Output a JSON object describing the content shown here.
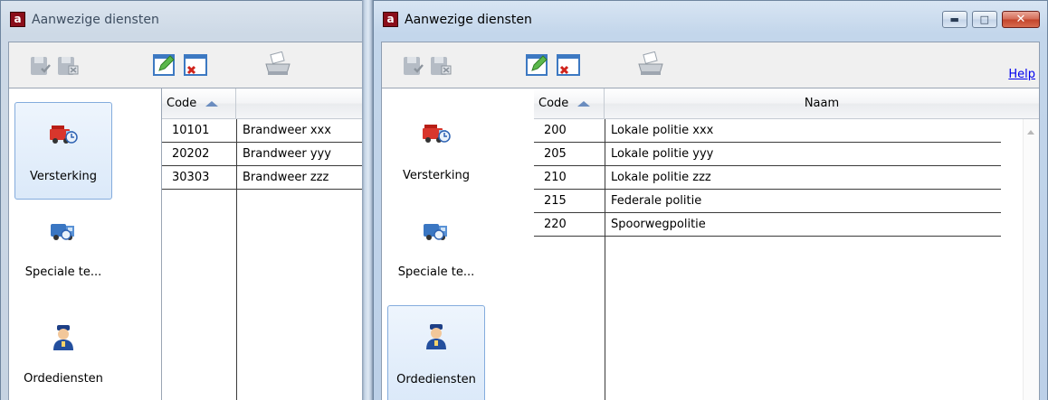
{
  "left_window": {
    "title": "Aanwezige diensten",
    "app_icon_letter": "a",
    "sidebar": [
      {
        "label": "Versterking",
        "icon": "fire-truck-icon",
        "selected": true
      },
      {
        "label": "Speciale te...",
        "icon": "special-truck-icon",
        "selected": false
      },
      {
        "label": "Ordediensten",
        "icon": "police-officer-icon",
        "selected": false
      }
    ],
    "columns": {
      "code": "Code",
      "name": ""
    },
    "rows": [
      {
        "code": "10101",
        "name": "Brandweer xxx"
      },
      {
        "code": "20202",
        "name": "Brandweer yyy"
      },
      {
        "code": "30303",
        "name": "Brandweer zzz"
      }
    ]
  },
  "right_window": {
    "title": "Aanwezige diensten",
    "app_icon_letter": "a",
    "controls": {
      "minimize": "▬",
      "maximize": "□",
      "close": "✕"
    },
    "help_label": "Help",
    "sidebar": [
      {
        "label": "Versterking",
        "icon": "fire-truck-icon",
        "selected": false
      },
      {
        "label": "Speciale te...",
        "icon": "special-truck-icon",
        "selected": false
      },
      {
        "label": "Ordediensten",
        "icon": "police-officer-icon",
        "selected": true
      }
    ],
    "columns": {
      "code": "Code",
      "name": "Naam"
    },
    "rows": [
      {
        "code": "200",
        "name": "Lokale politie xxx"
      },
      {
        "code": "205",
        "name": "Lokale politie yyy"
      },
      {
        "code": "210",
        "name": "Lokale politie zzz"
      },
      {
        "code": "215",
        "name": "Federale politie"
      },
      {
        "code": "220",
        "name": "Spoorwegpolitie"
      }
    ]
  },
  "toolbar_icons": [
    "save-check-icon",
    "save-cancel-icon",
    "edit-icon",
    "delete-icon",
    "print-icon"
  ],
  "colors": {
    "selection_border": "#84acdd",
    "app_icon": "#8b0e1a",
    "sort_arrow": "#6a8cbf",
    "help_link": "#0000ee"
  }
}
